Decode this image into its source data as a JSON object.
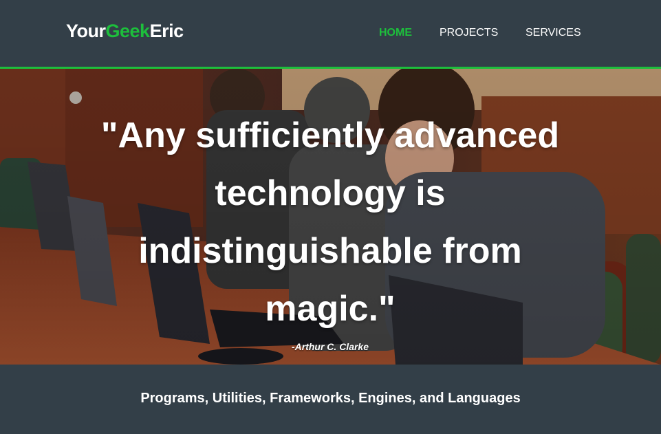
{
  "header": {
    "logo": {
      "part1": "Your",
      "part2": "Geek",
      "part3": "Eric"
    },
    "nav": [
      {
        "label": "HOME",
        "active": true
      },
      {
        "label": "PROJECTS",
        "active": false
      },
      {
        "label": "SERVICES",
        "active": false
      }
    ]
  },
  "hero": {
    "quote": "\"Any sufficiently advanced technology is indistinguishable from magic.\"",
    "attribution": "-Arthur C. Clarke",
    "image": "students-at-laptops-photo"
  },
  "tagline": "Programs, Utilities, Frameworks, Engines, and Languages",
  "colors": {
    "background": "#333f48",
    "accent": "#1dbf3c",
    "text": "#ffffff"
  }
}
